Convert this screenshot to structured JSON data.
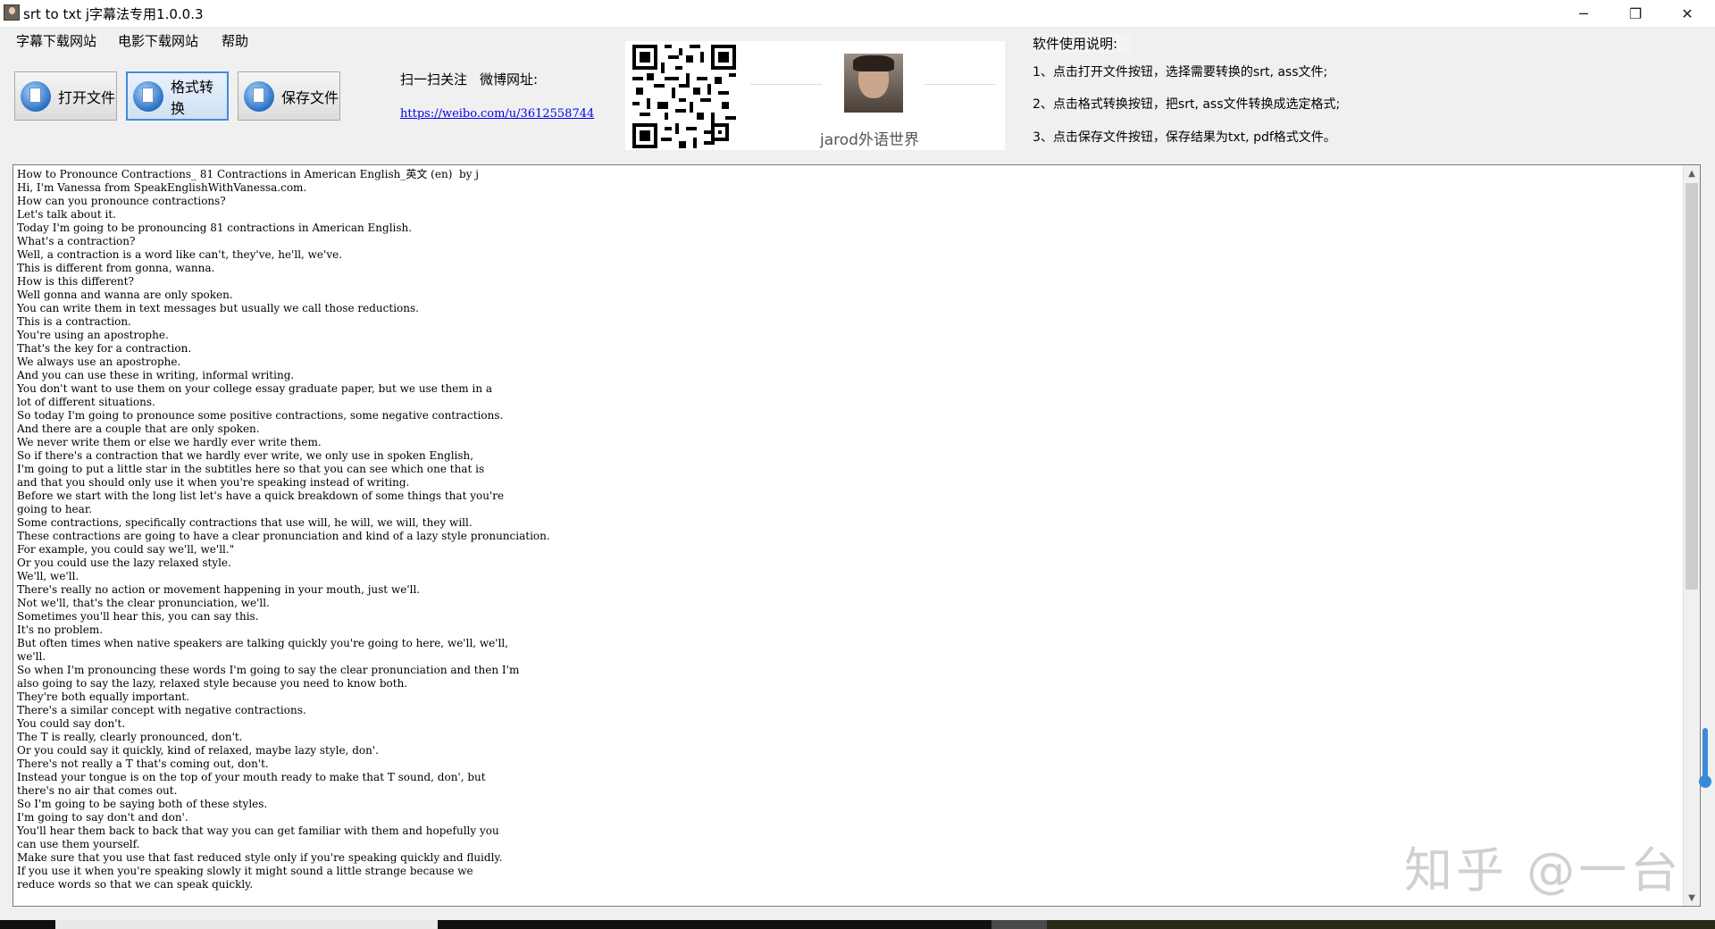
{
  "window": {
    "title": "srt to txt j字幕法专用1.0.0.3",
    "controls": {
      "minimize": "─",
      "maximize": "❐",
      "close": "✕"
    }
  },
  "menu": [
    {
      "label": "字幕下载网站"
    },
    {
      "label": "电影下载网站"
    },
    {
      "label": "帮助"
    }
  ],
  "toolbar": {
    "open_label": "打开文件",
    "convert_label": "格式转换",
    "save_label": "保存文件"
  },
  "promo": {
    "scan_label": "扫一扫关注",
    "weibo_label": "微博网址:",
    "weibo_url": "https://weibo.com/u/3612558744",
    "name": "jarod外语世界"
  },
  "help": {
    "title": "软件使用说明:",
    "steps": [
      "1、点击打开文件按钮，选择需要转换的srt, ass文件;",
      "2、点击格式转换按钮，把srt, ass文件转换成选定格式;",
      "3、点击保存文件按钮，保存结果为txt, pdf格式文件。"
    ]
  },
  "content": {
    "lines": [
      "How to Pronounce Contractions_ 81 Contractions in American English_英文 (en)  by j",
      "Hi, I'm Vanessa from SpeakEnglishWithVanessa.com.",
      "How can you pronounce contractions?",
      "Let's talk about it.",
      "Today I'm going to be pronouncing 81 contractions in American English.",
      "What's a contraction?",
      "Well, a contraction is a word like can't, they've, he'll, we've.",
      "This is different from gonna, wanna.",
      "How is this different?",
      "Well gonna and wanna are only spoken.",
      "You can write them in text messages but usually we call those reductions.",
      "This is a contraction.",
      "You're using an apostrophe.",
      "That's the key for a contraction.",
      "We always use an apostrophe.",
      "And you can use these in writing, informal writing.",
      "You don't want to use them on your college essay graduate paper, but we use them in a",
      "lot of different situations.",
      "So today I'm going to pronounce some positive contractions, some negative contractions.",
      "And there are a couple that are only spoken.",
      "We never write them or else we hardly ever write them.",
      "So if there's a contraction that we hardly ever write, we only use in spoken English,",
      "I'm going to put a little star in the subtitles here so that you can see which one that is",
      "and that you should only use it when you're speaking instead of writing.",
      "Before we start with the long list let's have a quick breakdown of some things that you're",
      "going to hear.",
      "Some contractions, specifically contractions that use will, he will, we will, they will.",
      "These contractions are going to have a clear pronunciation and kind of a lazy style pronunciation.",
      "For example, you could say we'll, we'll.\"",
      "Or you could use the lazy relaxed style.",
      "We'll, we'll.",
      "There's really no action or movement happening in your mouth, just we'll.",
      "Not we'll, that's the clear pronunciation, we'll.",
      "Sometimes you'll hear this, you can say this.",
      "It's no problem.",
      "But often times when native speakers are talking quickly you're going to here, we'll, we'll,",
      "we'll.",
      "So when I'm pronouncing these words I'm going to say the clear pronunciation and then I'm",
      "also going to say the lazy, relaxed style because you need to know both.",
      "They're both equally important.",
      "There's a similar concept with negative contractions.",
      "You could say don't.",
      "The T is really, clearly pronounced, don't.",
      "Or you could say it quickly, kind of relaxed, maybe lazy style, don'.",
      "There's not really a T that's coming out, don't.",
      "Instead your tongue is on the top of your mouth ready to make that T sound, don', but",
      "there's no air that comes out.",
      "So I'm going to be saying both of these styles.",
      "I'm going to say don't and don'.",
      "You'll hear them back to back that way you can get familiar with them and hopefully you",
      "can use them yourself.",
      "Make sure that you use that fast reduced style only if you're speaking quickly and fluidly.",
      "If you use it when you're speaking slowly it might sound a little strange because we",
      "reduce words so that we can speak quickly."
    ]
  },
  "watermark": "知乎 @一台"
}
